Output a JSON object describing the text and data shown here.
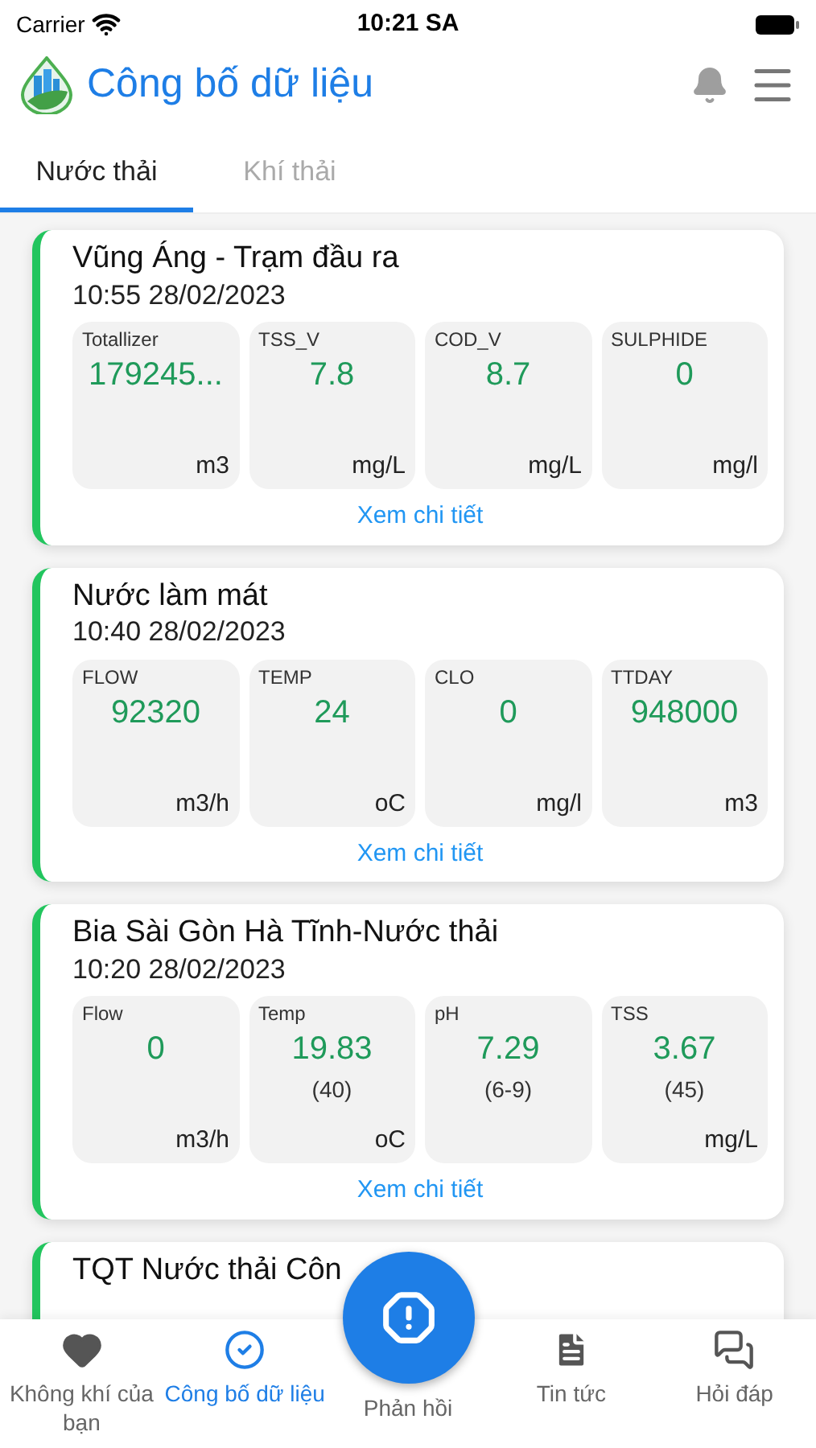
{
  "status_bar": {
    "carrier": "Carrier",
    "time": "10:21 SA"
  },
  "header": {
    "title": "Công bố dữ liệu"
  },
  "tabs": [
    {
      "label": "Nước thải",
      "selected": true
    },
    {
      "label": "Khí thải",
      "selected": false
    }
  ],
  "stations": [
    {
      "name": "Vũng Áng - Trạm đầu ra",
      "time": "10:55 28/02/2023",
      "link": "Xem chi tiết",
      "parameters": [
        {
          "label": "Totallizer",
          "value": "179245...",
          "unit": "m3"
        },
        {
          "label": "TSS_V",
          "value": "7.8",
          "unit": "mg/L"
        },
        {
          "label": "COD_V",
          "value": "8.7",
          "unit": "mg/L"
        },
        {
          "label": "SULPHIDE",
          "value": "0",
          "unit": "mg/l"
        }
      ]
    },
    {
      "name": "Nước làm mát",
      "time": "10:40 28/02/2023",
      "link": "Xem chi tiết",
      "parameters": [
        {
          "label": "FLOW",
          "value": "92320",
          "unit": "m3/h"
        },
        {
          "label": "TEMP",
          "value": "24",
          "unit": "oC"
        },
        {
          "label": "CLO",
          "value": "0",
          "unit": "mg/l"
        },
        {
          "label": "TTDAY",
          "value": "948000",
          "unit": "m3"
        }
      ]
    },
    {
      "name": "Bia Sài Gòn Hà Tĩnh-Nước thải",
      "time": "10:20 28/02/2023",
      "link": "Xem chi tiết",
      "parameters": [
        {
          "label": "Flow",
          "value": "0",
          "unit": "m3/h"
        },
        {
          "label": "Temp",
          "value": "19.83",
          "limit": "(40)",
          "unit": "oC"
        },
        {
          "label": "pH",
          "value": "7.29",
          "limit": "(6-9)"
        },
        {
          "label": "TSS",
          "value": "3.67",
          "limit": "(45)",
          "unit": "mg/L"
        }
      ]
    },
    {
      "name": "TQT Nước thải Côn"
    }
  ],
  "bottom_nav": [
    {
      "kind": "heart",
      "label": "Không khí của bạn",
      "selected": false
    },
    {
      "kind": "check",
      "label": "Công bố dữ liệu",
      "selected": true
    },
    {
      "kind": "feedback",
      "label": "Phản hồi",
      "selected": false
    },
    {
      "kind": "news",
      "label": "Tin tức",
      "selected": false
    },
    {
      "kind": "chat",
      "label": "Hỏi đáp",
      "selected": false
    }
  ]
}
